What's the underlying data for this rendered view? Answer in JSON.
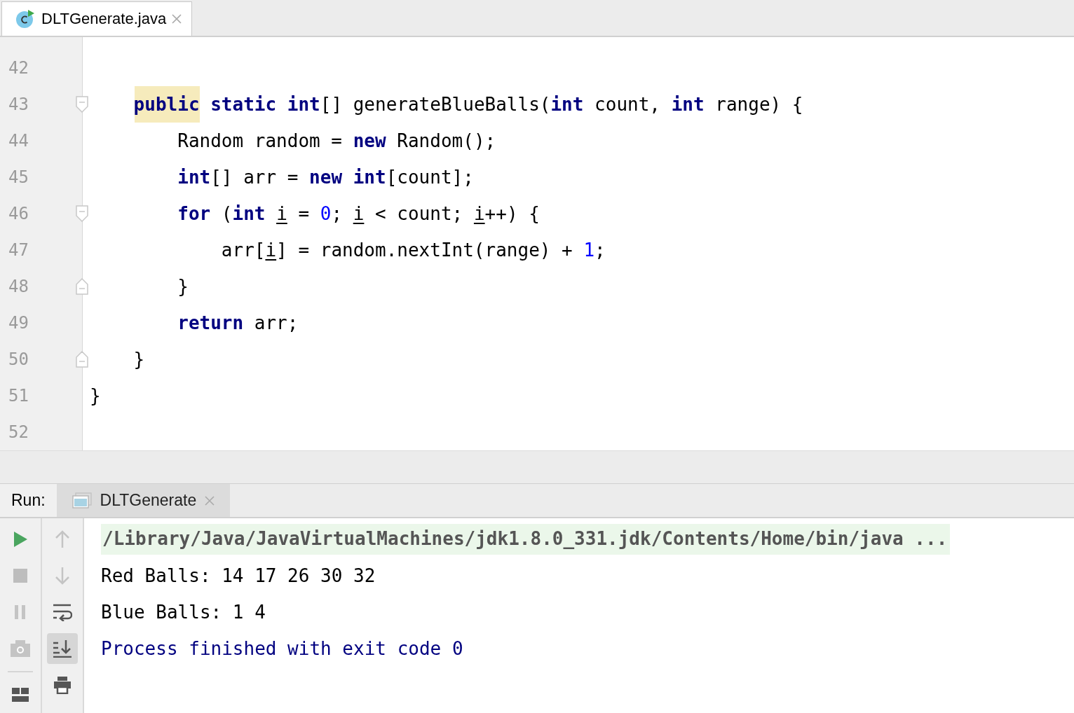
{
  "editor_tabs": [
    {
      "label": "DLTGenerate.java",
      "selected": true
    }
  ],
  "editor": {
    "lines": [
      {
        "number": "42",
        "fold_start": false,
        "fold_end": false
      },
      {
        "number": "43",
        "fold_start": true,
        "fold_end": false,
        "tokens": [
          {
            "kind": "marked",
            "text": "    public"
          },
          {
            "kind": "keyword",
            "text": " static int"
          },
          {
            "kind": "text",
            "text": "[] generateBlueBalls("
          },
          {
            "kind": "keyword",
            "text": "int"
          },
          {
            "kind": "text",
            "text": " count, "
          },
          {
            "kind": "keyword",
            "text": "int"
          },
          {
            "kind": "text",
            "text": " range) {"
          }
        ]
      },
      {
        "number": "44",
        "fold_start": false,
        "fold_end": false,
        "tokens": [
          {
            "kind": "text",
            "text": "        Random random = "
          },
          {
            "kind": "keyword",
            "text": "new"
          },
          {
            "kind": "text",
            "text": " Random();"
          }
        ]
      },
      {
        "number": "45",
        "fold_start": false,
        "fold_end": false,
        "tokens": [
          {
            "kind": "keyword",
            "text": "        int"
          },
          {
            "kind": "text",
            "text": "[] arr = "
          },
          {
            "kind": "keyword",
            "text": "new int"
          },
          {
            "kind": "text",
            "text": "[count];"
          }
        ]
      },
      {
        "number": "46",
        "fold_start": true,
        "fold_end": false,
        "tokens": [
          {
            "kind": "keyword",
            "text": "        for"
          },
          {
            "kind": "text",
            "text": " ("
          },
          {
            "kind": "keyword",
            "text": "int "
          },
          {
            "kind": "mutated",
            "text": "i"
          },
          {
            "kind": "text",
            "text": " = "
          },
          {
            "kind": "number",
            "text": "0"
          },
          {
            "kind": "text",
            "text": "; "
          },
          {
            "kind": "mutated",
            "text": "i"
          },
          {
            "kind": "text",
            "text": " < count; "
          },
          {
            "kind": "mutated",
            "text": "i"
          },
          {
            "kind": "text",
            "text": "++) {"
          }
        ]
      },
      {
        "number": "47",
        "fold_start": false,
        "fold_end": false,
        "tokens": [
          {
            "kind": "text",
            "text": "            arr["
          },
          {
            "kind": "mutated",
            "text": "i"
          },
          {
            "kind": "text",
            "text": "] = random.nextInt(range) + "
          },
          {
            "kind": "number",
            "text": "1"
          },
          {
            "kind": "text",
            "text": ";"
          }
        ]
      },
      {
        "number": "48",
        "fold_start": false,
        "fold_end": true,
        "tokens": [
          {
            "kind": "text",
            "text": "        }"
          }
        ]
      },
      {
        "number": "49",
        "fold_start": false,
        "fold_end": false,
        "tokens": [
          {
            "kind": "keyword",
            "text": "        return"
          },
          {
            "kind": "text",
            "text": " arr;"
          }
        ]
      },
      {
        "number": "50",
        "fold_start": false,
        "fold_end": true,
        "tokens": [
          {
            "kind": "text",
            "text": "    }"
          }
        ]
      },
      {
        "number": "51",
        "fold_start": false,
        "fold_end": false,
        "tokens": [
          {
            "kind": "text",
            "text": "}"
          }
        ]
      },
      {
        "number": "52",
        "fold_start": false,
        "fold_end": false
      }
    ]
  },
  "run_panel": {
    "label": "Run:",
    "tabs": [
      {
        "label": "DLTGenerate",
        "selected": true
      }
    ],
    "left_toolbar": [
      {
        "kind": "run"
      },
      {
        "kind": "stop"
      },
      {
        "kind": "pause"
      },
      {
        "kind": "camera"
      },
      {
        "kind": "layout"
      }
    ],
    "right_toolbar": [
      {
        "kind": "up",
        "on": false
      },
      {
        "kind": "down",
        "on": false
      },
      {
        "kind": "wrap",
        "on": false
      },
      {
        "kind": "scroll-end",
        "on": true
      },
      {
        "kind": "print",
        "on": false
      }
    ],
    "console": [
      {
        "kind": "command",
        "text": "/Library/Java/JavaVirtualMachines/jdk1.8.0_331.jdk/Contents/Home/bin/java ..."
      },
      {
        "kind": "output",
        "text": "Red Balls: 14 17 26 30 32"
      },
      {
        "kind": "output",
        "text": "Blue Balls: 1 4"
      },
      {
        "kind": "status",
        "text": "Process finished with exit code 0"
      }
    ]
  }
}
